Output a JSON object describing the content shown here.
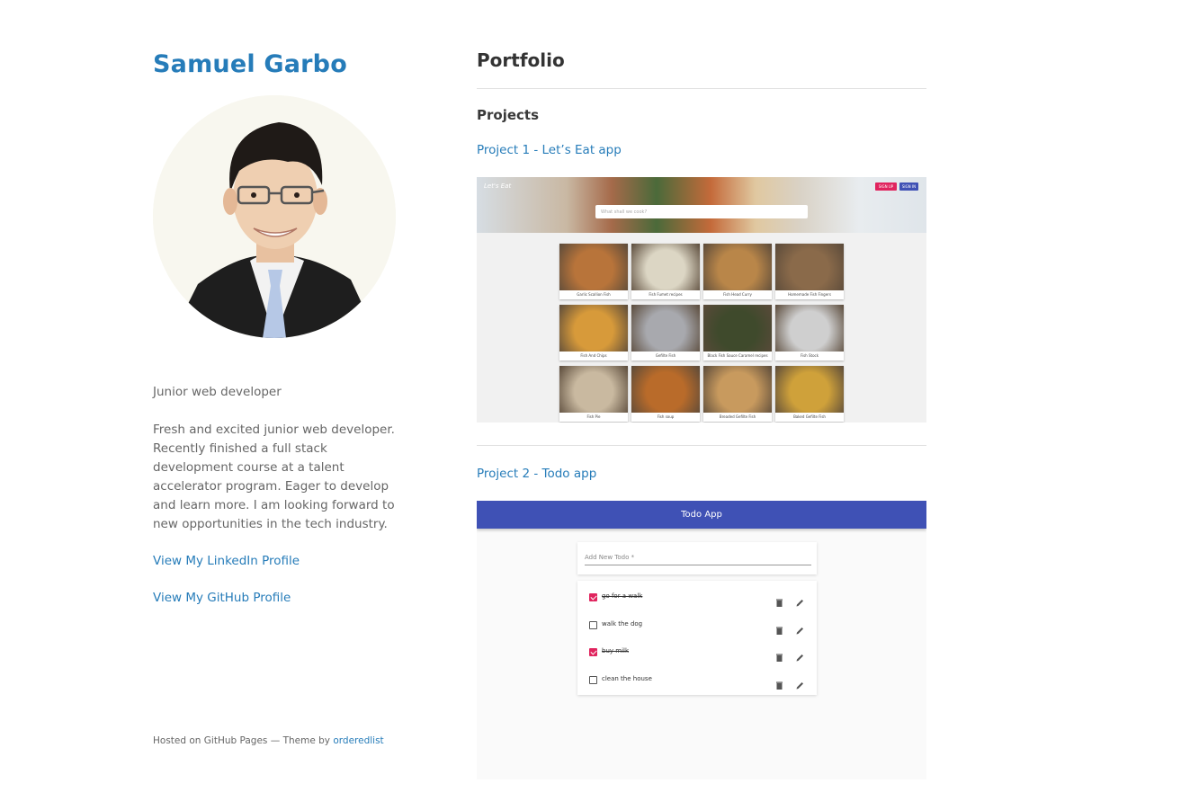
{
  "sidebar": {
    "name": "Samuel Garbo",
    "tagline": "Junior web developer",
    "bio": "Fresh and excited junior web developer. Recently finished a full stack development course at a talent accelerator program. Eager to develop and learn more. I am looking forward to new opportunities in the tech industry.",
    "linkedin_label": "View My LinkedIn Profile",
    "github_label": "View My GitHub Profile"
  },
  "footer": {
    "text": "Hosted on GitHub Pages — Theme by",
    "theme_link": "orderedlist"
  },
  "main": {
    "title": "Portfolio",
    "section": "Projects",
    "project1": {
      "label": "Project 1 - Let’s Eat app",
      "logo": "Let's Eat",
      "search_placeholder": "What shall we cook?",
      "signup_label": "SIGN UP",
      "signin_label": "SIGN IN",
      "cards": [
        {
          "caption": "Garlic Scallion Fish",
          "color": "#b8743a"
        },
        {
          "caption": "Fish Fumet recipes",
          "color": "#dcd6c4"
        },
        {
          "caption": "Fish Head Curry",
          "color": "#b98649"
        },
        {
          "caption": "Homemade Fish Fingers",
          "color": "#8a6a4a"
        },
        {
          "caption": "Fish And Chips",
          "color": "#d79a3a"
        },
        {
          "caption": "Gefilte Fish",
          "color": "#a8a9ae"
        },
        {
          "caption": "Black Fish Sauce Caramel recipes",
          "color": "#3f4a2c"
        },
        {
          "caption": "Fish Stock",
          "color": "#cfcfcf"
        },
        {
          "caption": "Fish Pie",
          "color": "#c9b9a0"
        },
        {
          "caption": "Fish soup",
          "color": "#b96b2a"
        },
        {
          "caption": "Breaded Gefilte Fish",
          "color": "#c89a5e"
        },
        {
          "caption": "Baked Gefilte Fish",
          "color": "#cfa13a"
        }
      ]
    },
    "project2": {
      "label": "Project 2 - Todo app",
      "app_title": "Todo App",
      "add_placeholder": "Add New Todo *",
      "todos": [
        {
          "text": "go for a walk",
          "done": true
        },
        {
          "text": "walk the dog",
          "done": false
        },
        {
          "text": "buy milk",
          "done": true
        },
        {
          "text": "clean the house",
          "done": false
        }
      ]
    }
  },
  "colors": {
    "link": "#267CB9",
    "todo_bar": "#3f51b5",
    "checkbox_checked": "#e0245e"
  }
}
